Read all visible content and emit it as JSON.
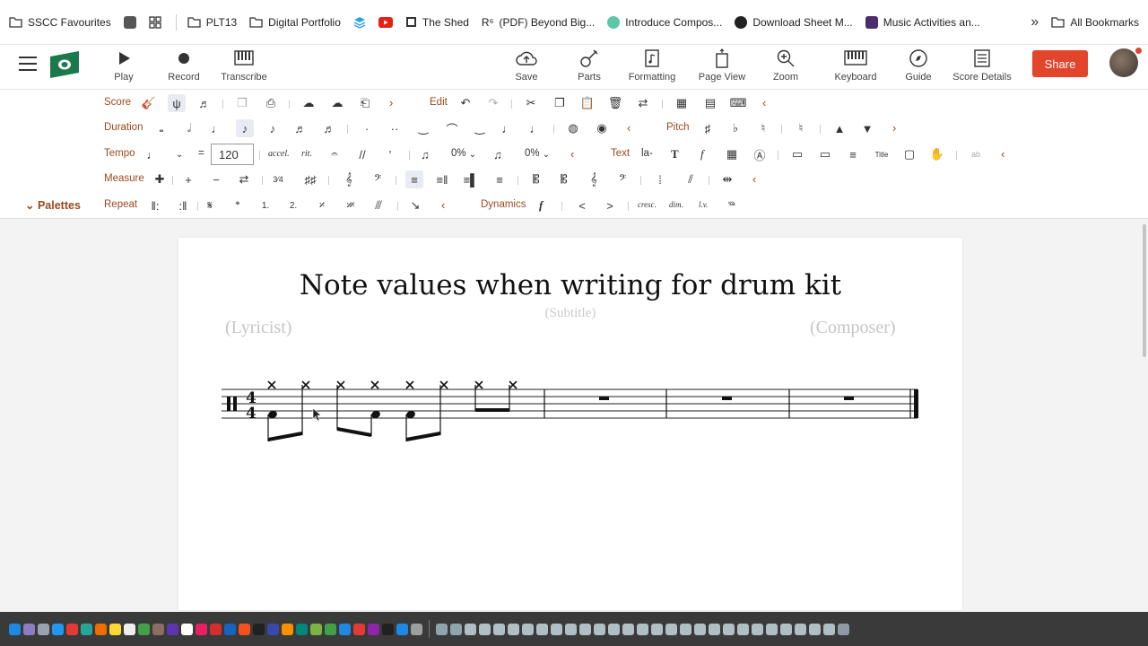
{
  "bookmarks": {
    "items": [
      {
        "label": "SSCC Favourites",
        "icon": "folder-icon"
      },
      {
        "label": "",
        "icon": "app-square-icon"
      },
      {
        "label": "",
        "icon": "apps-grid-icon"
      },
      {
        "label": "PLT13",
        "icon": "folder-icon"
      },
      {
        "label": "Digital Portfolio",
        "icon": "folder-icon"
      },
      {
        "label": "",
        "icon": "layers-icon"
      },
      {
        "label": "",
        "icon": "youtube-icon"
      },
      {
        "label": "The Shed",
        "icon": "page-icon"
      },
      {
        "label": "(PDF) Beyond Big...",
        "icon": "research-icon"
      },
      {
        "label": "Introduce Compos...",
        "icon": "site-icon"
      },
      {
        "label": "Download Sheet M...",
        "icon": "site-icon"
      },
      {
        "label": "Music Activities an...",
        "icon": "site-icon"
      }
    ],
    "more": "»",
    "all_bookmarks": "All Bookmarks"
  },
  "appbar": {
    "left": [
      {
        "label": "Play",
        "icon": "play-icon"
      },
      {
        "label": "Record",
        "icon": "record-icon"
      },
      {
        "label": "Transcribe",
        "icon": "piano-icon"
      }
    ],
    "right": [
      {
        "label": "Save",
        "icon": "cloud-upload-icon"
      },
      {
        "label": "Parts",
        "icon": "guitar-icon"
      },
      {
        "label": "Formatting",
        "icon": "score-page-icon"
      },
      {
        "label": "Page View",
        "icon": "page-view-icon"
      },
      {
        "label": "Zoom",
        "icon": "zoom-icon"
      },
      {
        "label": "Keyboard",
        "icon": "keyboard-icon"
      },
      {
        "label": "Guide",
        "icon": "compass-icon"
      },
      {
        "label": "Score Details",
        "icon": "list-icon"
      }
    ],
    "share": "Share"
  },
  "palette_rows": {
    "score": "Score",
    "edit": "Edit",
    "duration": "Duration",
    "pitch": "Pitch",
    "tempo": "Tempo",
    "tempo_value": "120",
    "tempo_equals": "=",
    "accel": "accel.",
    "rit": "rit.",
    "swing1": "0%",
    "swing2": "0%",
    "text": "Text",
    "text_la": "la-",
    "text_T": "T",
    "text_f": "f",
    "measure": "Measure",
    "repeat": "Repeat",
    "dynamics": "Dynamics",
    "dyn_f": "f",
    "cresc": "cresc.",
    "dim": "dim.",
    "lv": "l.v.",
    "palettes": "Palettes"
  },
  "score": {
    "title": "Note values when writing for drum kit",
    "subtitle": "(Subtitle)",
    "lyricist": "(Lyricist)",
    "composer": "(Composer)",
    "time_signature": "4/4"
  },
  "colors": {
    "accent": "#9a4a1f",
    "share": "#e2452b",
    "logo": "#1a7a4c"
  }
}
